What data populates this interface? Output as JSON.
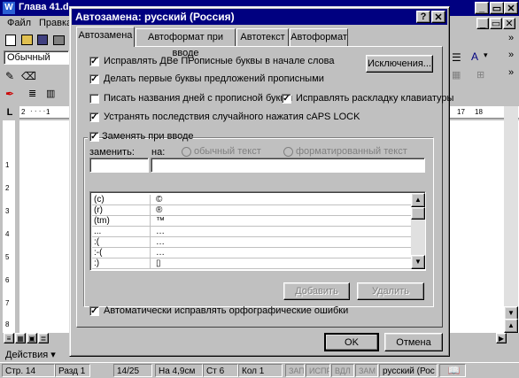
{
  "word": {
    "title": "Глава 41.d",
    "menu": [
      "Файл",
      "Правка"
    ],
    "style_box": "Обычный",
    "actions": "Действия",
    "ruler_marks": [
      "2",
      "1",
      "17",
      "18"
    ],
    "vruler_marks": [
      "1",
      "2",
      "3",
      "4",
      "5",
      "6",
      "7",
      "8"
    ],
    "status": {
      "page": "Стр. 14",
      "section": "Разд 1",
      "pages": "14/25",
      "at": "На 4,9см",
      "line": "Ст 6",
      "col": "Кол 1",
      "rec": "ЗАП",
      "trk": "ИСПР",
      "ext": "ВДЛ",
      "ovr": "ЗАМ",
      "lang": "русский (Рос"
    }
  },
  "dialog": {
    "title": "Автозамена: русский (Россия)",
    "help_btn": "?",
    "close_btn": "✕",
    "tabs": [
      "Автозамена",
      "Автоформат при вводе",
      "Автотекст",
      "Автоформат"
    ],
    "options": {
      "two_caps": "Исправлять ДВе ПРописные буквы в начале слова",
      "first_letter": "Делать первые буквы предложений прописными",
      "days": "Писать названия дней с прописной буквы",
      "keyboard": "Исправлять раскладку клавиатуры",
      "caps_lock": "Устранять последствия случайного нажатия cAPS LOCK",
      "replace": "Заменять при вводе",
      "auto_spell": "Автоматически исправлять орфографические ошибки"
    },
    "exceptions_btn": "Исключения...",
    "replace_label": "заменить:",
    "with_label": "на:",
    "plain_text": "обычный текст",
    "formatted_text": "форматированный текст",
    "replace_value": "",
    "with_value": "",
    "entries": [
      {
        "from": "(c)",
        "to": "©"
      },
      {
        "from": "(r)",
        "to": "®"
      },
      {
        "from": "(tm)",
        "to": "™"
      },
      {
        "from": "...",
        "to": "…"
      },
      {
        "from": ":(",
        "to": "…"
      },
      {
        "from": ":-(",
        "to": "…"
      },
      {
        "from": ":)",
        "to": "▯"
      }
    ],
    "add_btn": "Добавить",
    "delete_btn": "Удалить",
    "ok_btn": "OK",
    "cancel_btn": "Отмена"
  }
}
